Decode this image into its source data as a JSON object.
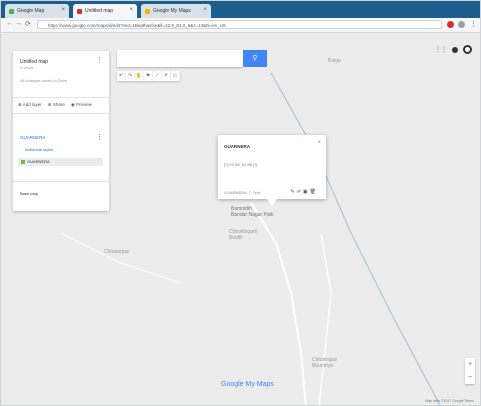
{
  "browser": {
    "tabs": [
      {
        "title": "Google Map",
        "active": false
      },
      {
        "title": "Untitled map",
        "active": true
      },
      {
        "title": "Google My Maps",
        "active": false
      }
    ],
    "url": "https://www.google.com/maps/d/edit?mid=1Baathaxfxe&ll=22.9_81.0_6&z=13&hl=en_US"
  },
  "map_panel": {
    "title": "Untitled map",
    "subtitle": "0 views",
    "description": "All changes saved in Drive",
    "actions": {
      "add_layer": "Add layer",
      "share": "Share",
      "preview": "Preview"
    },
    "layer_title": "GUARNERA",
    "layer_link": "Individual styles",
    "layer_item": "GUARNERA",
    "base_map": "Base map"
  },
  "search": {
    "placeholder": ""
  },
  "info_window": {
    "title": "GUARNERA",
    "coords": "[?] 22.95, 81.98 [?]",
    "footer": "GUARNERA ⓘ Text"
  },
  "map_labels": {
    "top_right": "Baiga",
    "marker_label": "Bamnidih\nBandar Nagar Patti",
    "under_marker": "Chhattisgarh\nBiridih",
    "left": "Chhatarpur",
    "bottom_right": "Chhatrapur\nBhundiya"
  },
  "branding": {
    "logo": "Google My Maps",
    "footer": "Map data ©2017 Google  Terms"
  },
  "colors": {
    "tab_bar": "#1c5f8f",
    "accent": "#4285f4",
    "map_bg": "#ececec"
  }
}
